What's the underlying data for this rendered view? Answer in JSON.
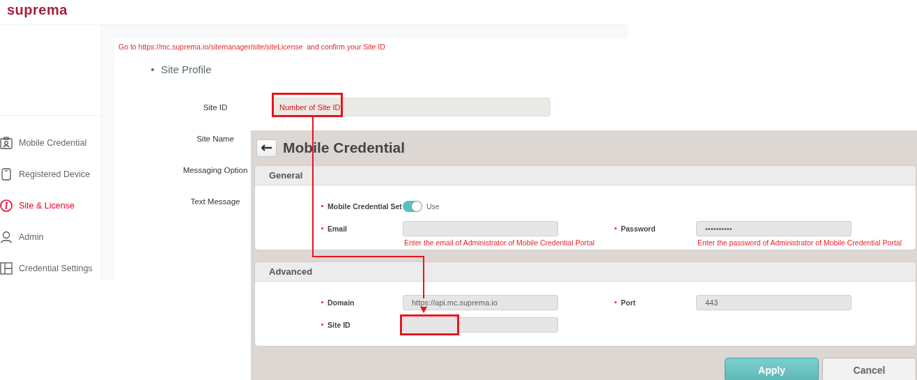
{
  "page": {
    "logo": "suprema",
    "sidebar": {
      "items": [
        {
          "label": "Mobile Credential",
          "selected": false
        },
        {
          "label": "Registered Device",
          "selected": false
        },
        {
          "label": "Site & License",
          "selected": true
        },
        {
          "label": "Admin",
          "selected": false
        },
        {
          "label": "Credential Settings",
          "selected": false
        }
      ]
    },
    "notice": "Go to https://mc.suprema.io/sitemanager/site/siteLicense  and confirm your Site ID",
    "section_title": "Site Profile",
    "form": {
      "rows": [
        {
          "label": "Site ID",
          "placeholder": "Number of Site ID"
        },
        {
          "label": "Site Name"
        },
        {
          "label": "Messaging Option"
        },
        {
          "label": "Text Message"
        }
      ]
    }
  },
  "dialog": {
    "title": "Mobile Credential",
    "sections": [
      {
        "title": "General",
        "rows": [
          [
            {
              "kind": "toggle",
              "label": "Mobile Credential Set",
              "required": true,
              "on": true,
              "text": "Use"
            }
          ],
          [
            {
              "kind": "input",
              "label": "Email",
              "required": true,
              "hint": "Enter the email of Administrator of Mobile Credential Portal"
            },
            {
              "kind": "input",
              "label": "Password",
              "required": true,
              "value": "••••••••••",
              "hint": "Enter the password of Administrator of Mobile Credential Portal"
            }
          ]
        ]
      },
      {
        "title": "Advanced",
        "rows": [
          [
            {
              "kind": "input",
              "label": "Domain",
              "required": true,
              "value": "https://api.mc.suprema.io"
            },
            {
              "kind": "input",
              "label": "Port",
              "required": true,
              "value": "443"
            }
          ],
          [
            {
              "kind": "input",
              "label": "Site ID",
              "required": true
            }
          ]
        ]
      }
    ],
    "buttons": [
      {
        "label": "Apply",
        "kind": "primary"
      },
      {
        "label": "Cancel",
        "kind": "secondary"
      }
    ]
  }
}
